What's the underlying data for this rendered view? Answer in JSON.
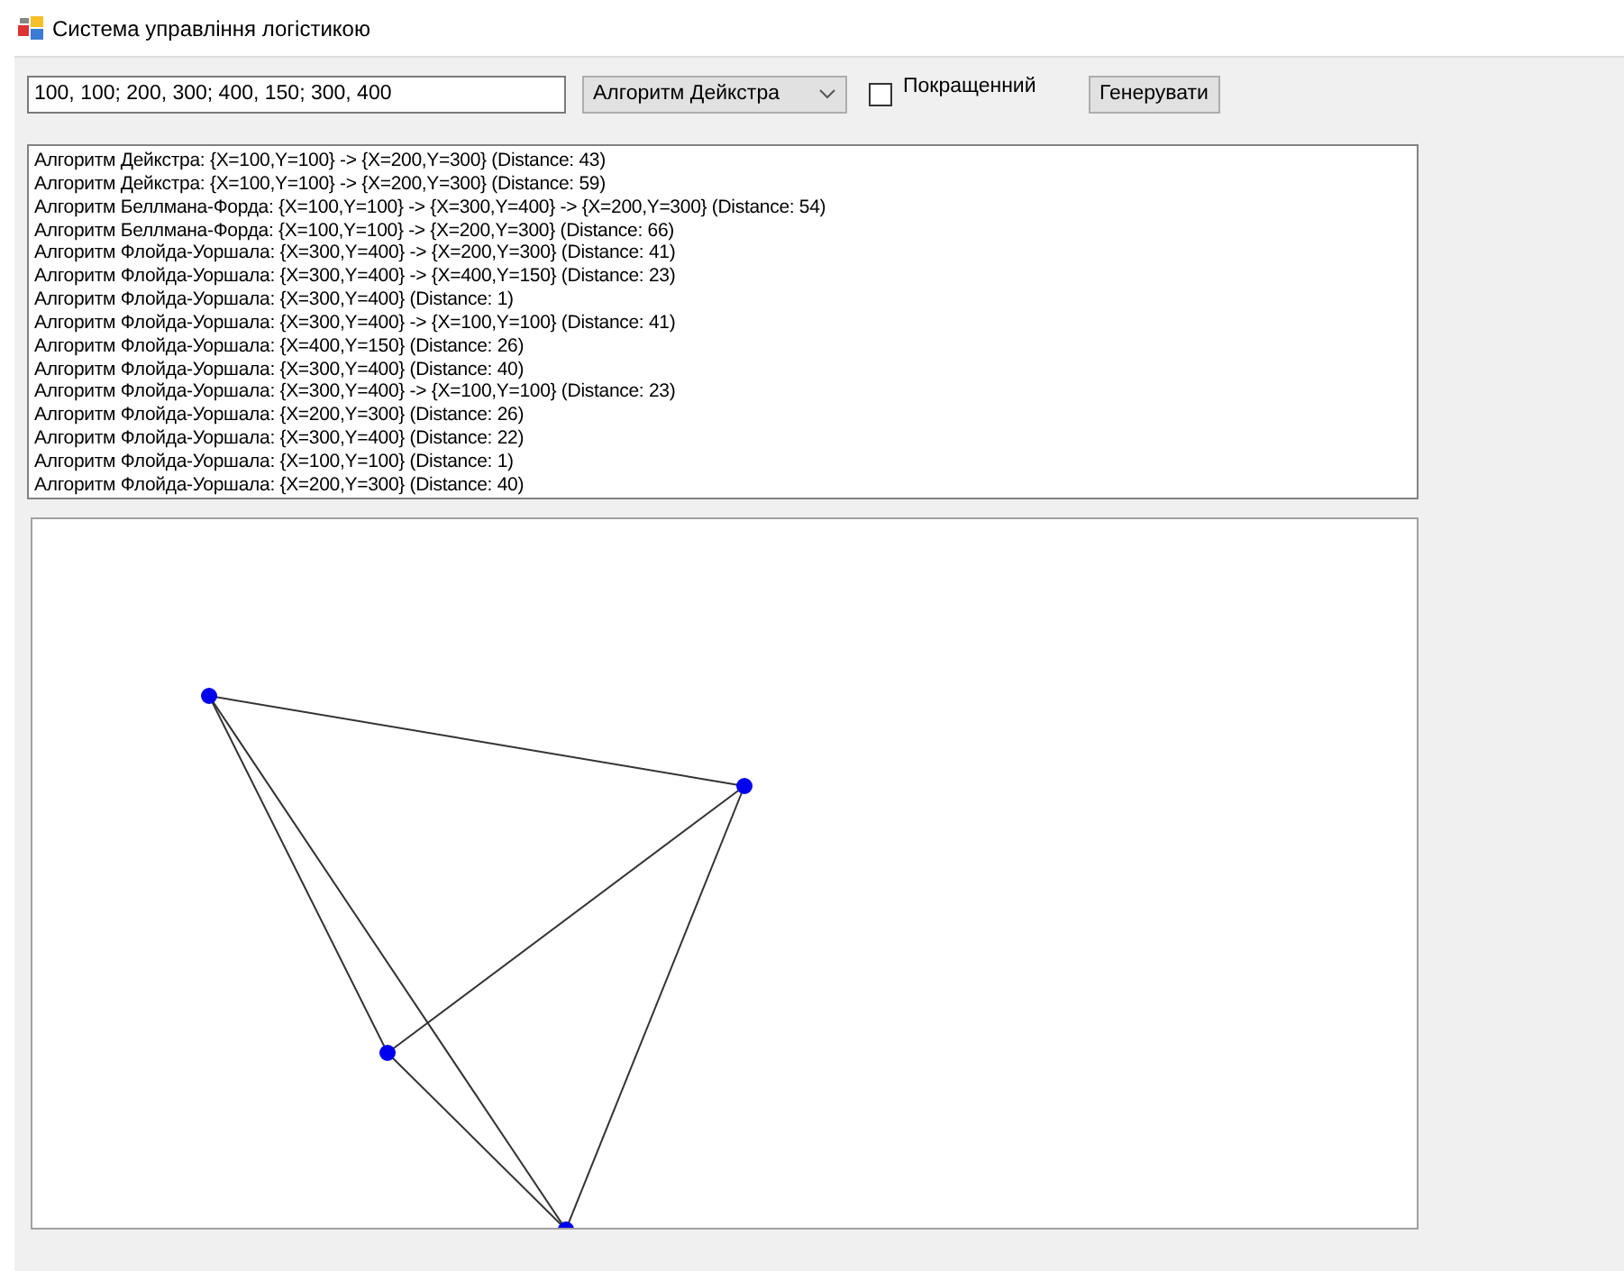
{
  "window": {
    "title": "Система управління логістикою"
  },
  "toolbar": {
    "points_field": {
      "value": "100, 100; 200, 300; 400, 150; 300, 400"
    },
    "algorithm_select": {
      "value": "Алгоритм Дейкстра"
    },
    "improved_checkbox": {
      "label": "Покращенний",
      "checked": false
    },
    "generate_button": {
      "label": "Генерувати"
    }
  },
  "results_list": {
    "items": [
      "Алгоритм Дейкстра: {X=100,Y=100} -> {X=200,Y=300} (Distance: 43)",
      "Алгоритм Дейкстра: {X=100,Y=100} -> {X=200,Y=300} (Distance: 59)",
      "Алгоритм Беллмана-Форда: {X=100,Y=100} -> {X=300,Y=400} -> {X=200,Y=300} (Distance: 54)",
      "Алгоритм Беллмана-Форда: {X=100,Y=100} -> {X=200,Y=300} (Distance: 66)",
      "Алгоритм Флойда-Уоршала: {X=300,Y=400} -> {X=200,Y=300} (Distance: 41)",
      "Алгоритм Флойда-Уоршала: {X=300,Y=400} -> {X=400,Y=150} (Distance: 23)",
      "Алгоритм Флойда-Уоршала: {X=300,Y=400} (Distance: 1)",
      "Алгоритм Флойда-Уоршала: {X=300,Y=400} -> {X=100,Y=100} (Distance: 41)",
      "Алгоритм Флойда-Уоршала: {X=400,Y=150} (Distance: 26)",
      "Алгоритм Флойда-Уоршала: {X=300,Y=400} (Distance: 40)",
      "Алгоритм Флойда-Уоршала: {X=300,Y=400} -> {X=100,Y=100} (Distance: 23)",
      "Алгоритм Флойда-Уоршала: {X=200,Y=300} (Distance: 26)",
      "Алгоритм Флойда-Уоршала: {X=300,Y=400} (Distance: 22)",
      "Алгоритм Флойда-Уоршала: {X=100,Y=100} (Distance: 1)",
      "Алгоритм Флойда-Уоршала: {X=200,Y=300} (Distance: 40)"
    ]
  }
}
